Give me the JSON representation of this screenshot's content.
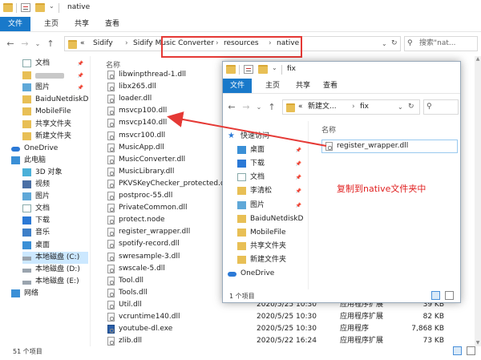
{
  "back_window": {
    "title": "native",
    "ribbon_tabs": [
      "文件",
      "主页",
      "共享",
      "查看"
    ],
    "breadcrumb": [
      "«",
      "Sidify",
      "Sidify Music Converter",
      "resources",
      "native"
    ],
    "search_placeholder": "搜索\"nat...",
    "sidebar": [
      {
        "label": "文档",
        "pinned": true,
        "icon": "document-icon"
      },
      {
        "label": "",
        "pinned": true,
        "icon": "folder-icon"
      },
      {
        "label": "图片",
        "pinned": true,
        "icon": "picture-icon"
      },
      {
        "label": "BaiduNetdiskD",
        "pinned": false,
        "icon": "folder-icon"
      },
      {
        "label": "MobileFile",
        "pinned": false,
        "icon": "folder-icon"
      },
      {
        "label": "共享文件夹",
        "pinned": false,
        "icon": "folder-icon"
      },
      {
        "label": "新建文件夹",
        "pinned": false,
        "icon": "folder-icon"
      },
      {
        "label": "OneDrive",
        "pinned": false,
        "icon": "onedrive-icon"
      },
      {
        "label": "此电脑",
        "pinned": false,
        "icon": "computer-icon"
      },
      {
        "label": "3D 对象",
        "pinned": false,
        "icon": "3d-objects-icon"
      },
      {
        "label": "视频",
        "pinned": false,
        "icon": "video-icon"
      },
      {
        "label": "图片",
        "pinned": false,
        "icon": "picture-icon"
      },
      {
        "label": "文档",
        "pinned": false,
        "icon": "document-icon"
      },
      {
        "label": "下载",
        "pinned": false,
        "icon": "download-icon"
      },
      {
        "label": "音乐",
        "pinned": false,
        "icon": "music-icon"
      },
      {
        "label": "桌面",
        "pinned": false,
        "icon": "desktop-icon"
      },
      {
        "label": "本地磁盘 (C:)",
        "pinned": false,
        "icon": "drive-icon"
      },
      {
        "label": "本地磁盘 (D:)",
        "pinned": false,
        "icon": "drive-icon"
      },
      {
        "label": "本地磁盘 (E:)",
        "pinned": false,
        "icon": "drive-icon"
      },
      {
        "label": "网络",
        "pinned": false,
        "icon": "network-icon"
      }
    ],
    "column_name": "名称",
    "files": [
      {
        "name": "libwinpthread-1.dll"
      },
      {
        "name": "libx265.dll"
      },
      {
        "name": "loader.dll"
      },
      {
        "name": "msvcp100.dll"
      },
      {
        "name": "msvcp140.dll"
      },
      {
        "name": "msvcr100.dll"
      },
      {
        "name": "MusicApp.dll"
      },
      {
        "name": "MusicConverter.dll"
      },
      {
        "name": "MusicLibrary.dll"
      },
      {
        "name": "PKVSKeyChecker_protected.dll"
      },
      {
        "name": "postproc-55.dll"
      },
      {
        "name": "PrivateCommon.dll"
      },
      {
        "name": "protect.node"
      },
      {
        "name": "register_wrapper.dll"
      },
      {
        "name": "spotify-record.dll"
      },
      {
        "name": "swresample-3.dll"
      },
      {
        "name": "swscale-5.dll"
      },
      {
        "name": "Tool.dll"
      },
      {
        "name": "Tools.dll"
      },
      {
        "name": "Util.dll",
        "date": "2020/5/25 10:30",
        "type": "应用程序扩展",
        "size": "39 KB"
      },
      {
        "name": "vcruntime140.dll",
        "date": "2020/5/25 10:30",
        "type": "应用程序扩展",
        "size": "82 KB"
      },
      {
        "name": "youtube-dl.exe",
        "date": "2020/5/25 10:30",
        "type": "应用程序",
        "size": "7,868 KB"
      },
      {
        "name": "zlib.dll",
        "date": "2020/5/22 16:24",
        "type": "应用程序扩展",
        "size": "73 KB"
      }
    ],
    "status": "51 个项目"
  },
  "front_window": {
    "title": "fix",
    "ribbon_tabs": [
      "文件",
      "主页",
      "共享",
      "查看"
    ],
    "breadcrumb": [
      "«",
      "新建文...",
      "fix"
    ],
    "sidebar": [
      {
        "label": "快速访问",
        "pinned": false,
        "icon": "star-icon"
      },
      {
        "label": "桌面",
        "pinned": true,
        "icon": "desktop-icon"
      },
      {
        "label": "下载",
        "pinned": true,
        "icon": "download-icon"
      },
      {
        "label": "文档",
        "pinned": true,
        "icon": "document-icon"
      },
      {
        "label": "李清松",
        "pinned": true,
        "icon": "folder-icon"
      },
      {
        "label": "图片",
        "pinned": true,
        "icon": "picture-icon"
      },
      {
        "label": "BaiduNetdiskD",
        "pinned": false,
        "icon": "folder-icon"
      },
      {
        "label": "MobileFile",
        "pinned": false,
        "icon": "folder-icon"
      },
      {
        "label": "共享文件夹",
        "pinned": false,
        "icon": "folder-icon"
      },
      {
        "label": "新建文件夹",
        "pinned": false,
        "icon": "folder-icon"
      },
      {
        "label": "OneDrive",
        "pinned": false,
        "icon": "onedrive-icon"
      }
    ],
    "column_name": "名称",
    "files": [
      {
        "name": "register_wrapper.dll"
      }
    ],
    "status": "1 个项目"
  },
  "annotation": {
    "text": "复制到native文件夹中",
    "color": "#e02020"
  },
  "colors": {
    "accent": "#1979ca",
    "selection": "#cce8ff",
    "annotation_red": "#e53935"
  }
}
